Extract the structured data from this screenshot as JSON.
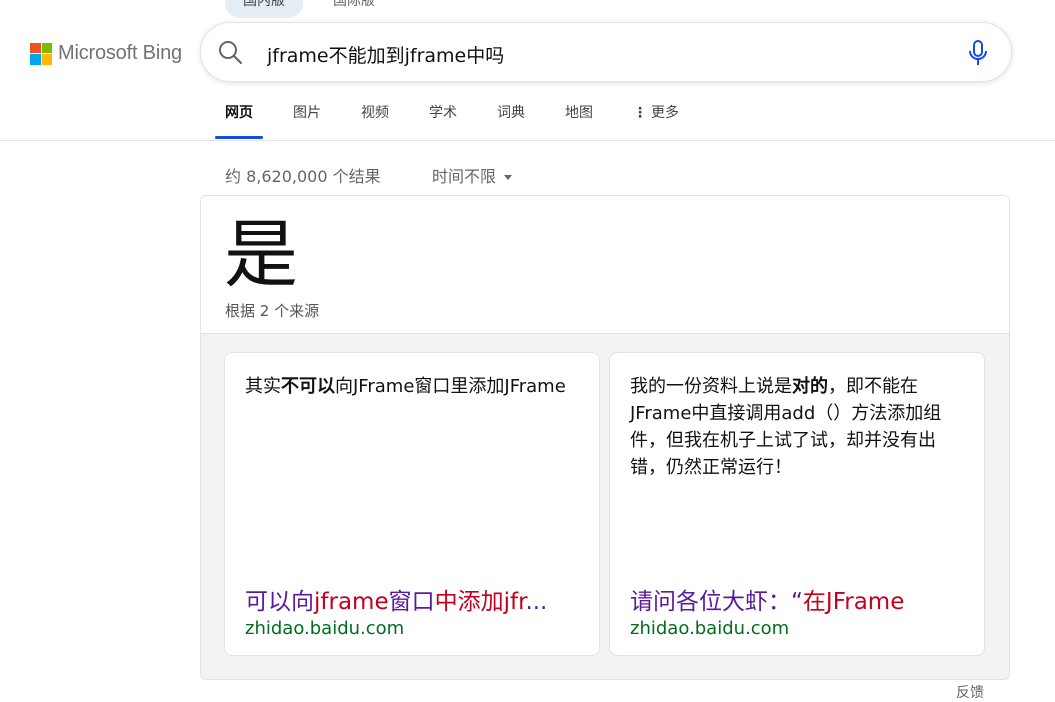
{
  "region_tabs": [
    {
      "label": "国内版",
      "active": true
    },
    {
      "label": "国际版",
      "active": false
    }
  ],
  "logo": {
    "text": "Microsoft Bing",
    "colors": [
      "#f25022",
      "#7fba00",
      "#00a4ef",
      "#ffb900"
    ]
  },
  "search": {
    "query": "jframe不能加到jframe中吗"
  },
  "scopes": [
    {
      "label": "网页",
      "active": true
    },
    {
      "label": "图片",
      "active": false
    },
    {
      "label": "视频",
      "active": false
    },
    {
      "label": "学术",
      "active": false
    },
    {
      "label": "词典",
      "active": false
    },
    {
      "label": "地图",
      "active": false
    },
    {
      "label": "更多",
      "active": false
    }
  ],
  "results": {
    "count_text": "约 8,620,000 个结果",
    "time_filter": "时间不限"
  },
  "answer": {
    "big": "是",
    "sub": "根据 2 个来源",
    "sources": [
      {
        "text_parts": [
          {
            "t": "其实",
            "b": false
          },
          {
            "t": "不可以",
            "b": true
          },
          {
            "t": "向JFrame窗口里添加JFrame",
            "b": false
          }
        ],
        "title_parts": [
          {
            "t": "可以向",
            "c": "p"
          },
          {
            "t": "jframe",
            "c": "r"
          },
          {
            "t": "窗口",
            "c": "p"
          },
          {
            "t": "中添加jfr",
            "c": "r"
          },
          {
            "t": "...",
            "c": "p"
          }
        ],
        "host": "zhidao.baidu.com"
      },
      {
        "text_parts": [
          {
            "t": "我的一份资料上说是",
            "b": false
          },
          {
            "t": "对的",
            "b": true
          },
          {
            "t": "，即不能在JFrame中直接调用add（）方法添加组件，但我在机子上试了试，却并没有出错，仍然正常运行！",
            "b": false
          }
        ],
        "title_parts": [
          {
            "t": "请问各位大虾：“",
            "c": "p"
          },
          {
            "t": "在JFrame",
            "c": "r"
          }
        ],
        "host": "zhidao.baidu.com"
      }
    ]
  },
  "feedback": "反馈",
  "colors": {
    "accent": "#174ae4",
    "link_visited": "#5b1a9e",
    "link_highlight": "#c4001d",
    "url_green": "#006d21"
  }
}
